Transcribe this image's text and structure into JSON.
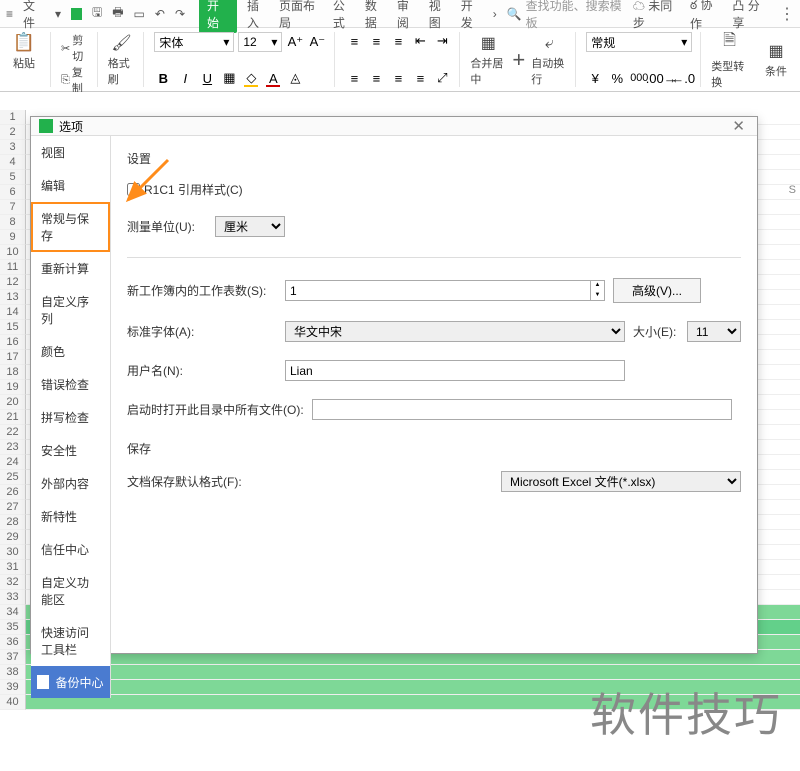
{
  "menubar": {
    "file": "文件",
    "tabs": [
      "开始",
      "插入",
      "页面布局",
      "公式",
      "数据",
      "审阅",
      "视图",
      "开发"
    ],
    "search_placeholder": "查找功能、搜索模板",
    "sync": "未同步",
    "coop": "协作",
    "share": "分享"
  },
  "ribbon": {
    "cut": "剪切",
    "copy": "复制",
    "paste": "粘贴",
    "formatPainter": "格式刷",
    "font_name": "宋体",
    "font_size": "12",
    "merge": "合并居中",
    "wrap": "自动换行",
    "numfmt": "常规",
    "typeconv": "类型转换",
    "condfmt": "条件"
  },
  "sheet_col": "S",
  "dialog": {
    "title": "选项",
    "sidebar": [
      "视图",
      "编辑",
      "常规与保存",
      "重新计算",
      "自定义序列",
      "颜色",
      "错误检查",
      "拼写检查",
      "安全性",
      "外部内容",
      "新特性",
      "信任中心",
      "自定义功能区",
      "快速访问工具栏"
    ],
    "selected": "常规与保存",
    "backup": "备份中心",
    "settings_label": "设置",
    "r1c1_label": "R1C1 引用样式(C)",
    "unit_label": "测量单位(U):",
    "unit_value": "厘米",
    "sheets_label": "新工作簿内的工作表数(S):",
    "sheets_value": "1",
    "adv_btn": "高级(V)...",
    "stdfont_label": "标准字体(A):",
    "stdfont_value": "华文中宋",
    "size_label": "大小(E):",
    "size_value": "11",
    "user_label": "用户名(N):",
    "user_value": "Lian",
    "startdir_label": "启动时打开此目录中所有文件(O):",
    "startdir_value": "",
    "save_section": "保存",
    "saveas_label": "文档保存默认格式(F):",
    "saveas_value": "Microsoft Excel 文件(*.xlsx)"
  },
  "watermark": "软件技巧"
}
